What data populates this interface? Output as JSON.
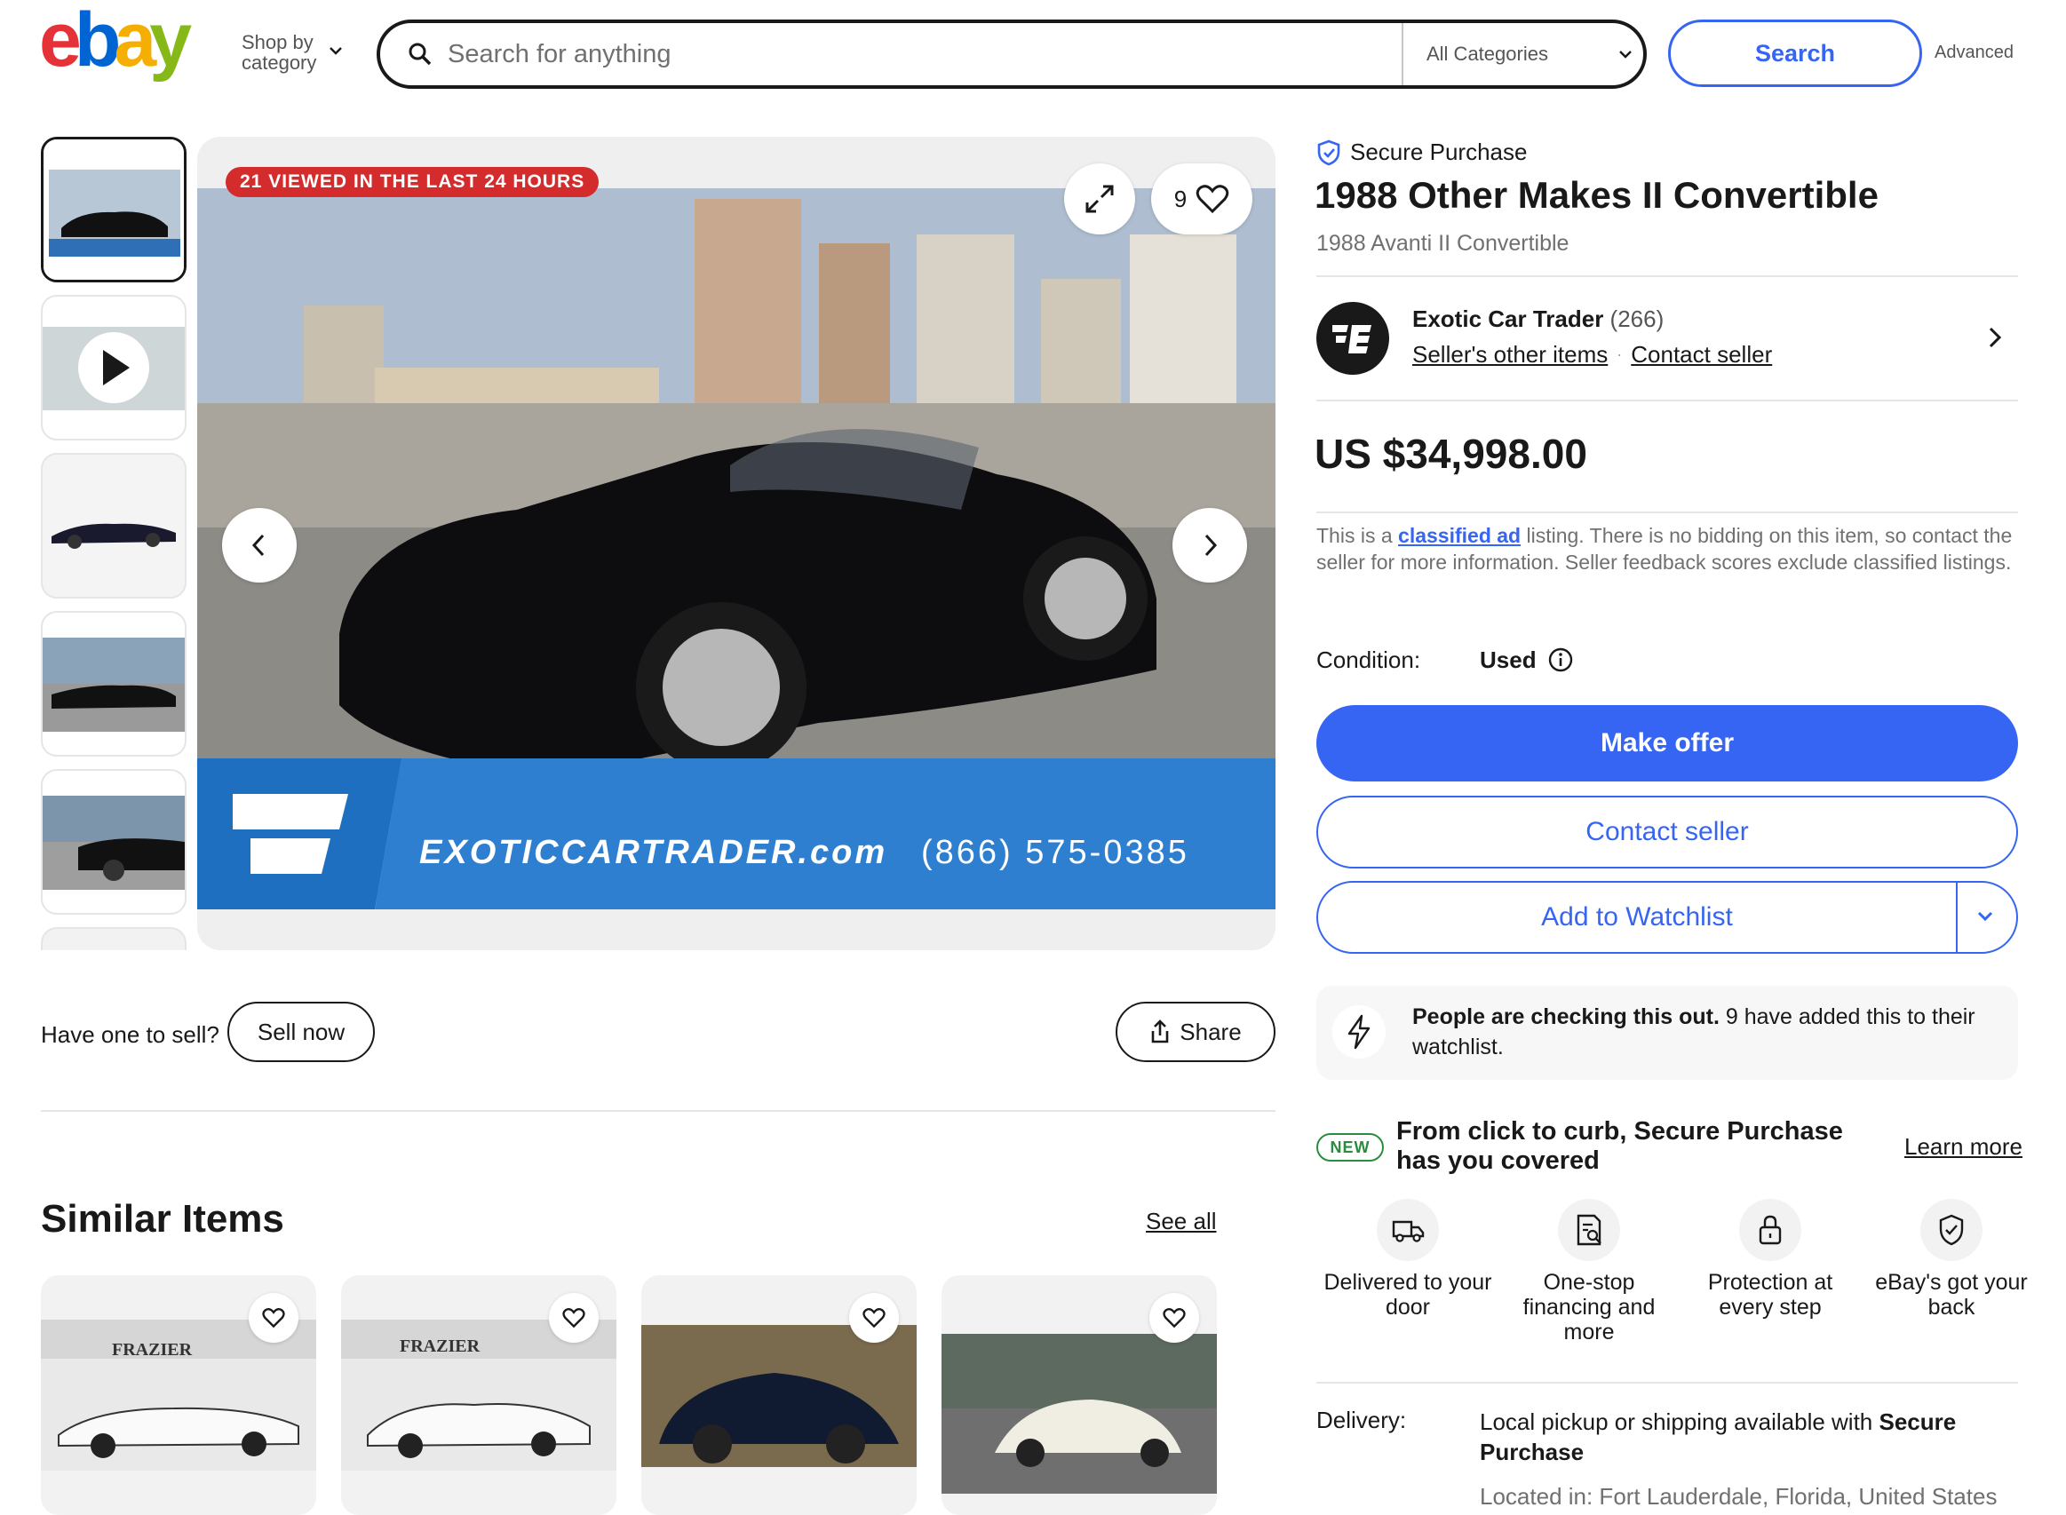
{
  "header": {
    "shop_by_line1": "Shop by",
    "shop_by_line2": "category",
    "search_placeholder": "Search for anything",
    "category": "All Categories",
    "search_button": "Search",
    "advanced": "Advanced",
    "logo_letters": [
      "e",
      "b",
      "a",
      "y"
    ],
    "logo_colors": [
      "#e53238",
      "#0064d2",
      "#f5af02",
      "#86b817"
    ]
  },
  "gallery": {
    "viewed_badge": "21 VIEWED IN THE LAST 24 HOURS",
    "watch_count": "9",
    "banner_text": "EXOTICCARTRADER.com",
    "banner_phone": "(866) 575-0385"
  },
  "sell": {
    "prompt": "Have one to sell?",
    "sell_now": "Sell now",
    "share": "Share"
  },
  "similar": {
    "title": "Similar Items",
    "see_all": "See all",
    "card_brand": "FRAZIER"
  },
  "listing": {
    "secure": "Secure Purchase",
    "title": "1988 Other Makes II Convertible",
    "subtitle": "1988 Avanti II Convertible",
    "seller_name": "Exotic Car Trader",
    "seller_feedback": "(266)",
    "seller_other": "Seller's other items",
    "contact_seller_link": "Contact seller",
    "price": "US $34,998.00",
    "classified_pre": "This is a ",
    "classified_link": "classified ad",
    "classified_post": " listing. There is no bidding on this item, so contact the seller for more information. Seller feedback scores exclude classified listings.",
    "condition_label": "Condition:",
    "condition_value": "Used",
    "make_offer": "Make offer",
    "contact_seller": "Contact seller",
    "add_watchlist": "Add to Watchlist",
    "people_bold": "People are checking this out.",
    "people_rest": " 9 have added this to their watchlist.",
    "new_badge": "NEW",
    "sp_heading": "From click to curb, Secure Purchase has you covered",
    "learn_more": "Learn more",
    "features": [
      {
        "label": "Delivered to your door"
      },
      {
        "label": "One-stop financing and more"
      },
      {
        "label": "Protection at every step"
      },
      {
        "label": "eBay's got your back"
      }
    ],
    "delivery_label": "Delivery:",
    "delivery_pre": "Local pickup or shipping available with ",
    "delivery_bold": "Secure Purchase",
    "located": "Located in: Fort Lauderdale, Florida, United States"
  }
}
